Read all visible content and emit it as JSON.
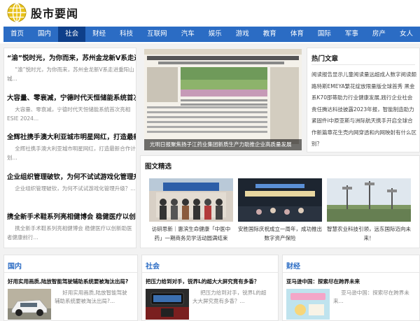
{
  "header": {
    "site_title": "股市要闻",
    "logo_icon": "globe-icon"
  },
  "nav": {
    "items": [
      "首页",
      "国内",
      "社会",
      "财经",
      "科技",
      "互联网",
      "汽车",
      "娱乐",
      "游戏",
      "教育",
      "体育",
      "国际",
      "军事",
      "房产",
      "女人"
    ],
    "active_index": 2
  },
  "colors": {
    "accent": "#2b6cc4",
    "nav_active": "#0e3f8a"
  },
  "left_news": [
    {
      "title": "“渝”悦时光，为你而来，苏州金龙新V系走进重",
      "desc": "“渝”悦时光，为你而来，苏州金龙新V系走进重阳山城..."
    },
    {
      "title": "大容量、零衰减，宁德时代天恒储能系统首次亮",
      "desc": "大容量、零衰减，宁德时代天恒储能系统首次亮相ESIE 2024..."
    },
    {
      "title": "全辉社携手澳大利亚城市明星网红，打造最新合",
      "desc": "全辉社携手澳大利亚城市明星网红，打造最新合作计划..."
    },
    {
      "title": "企业组织管理破钦，为何不试试游戏化管理升级",
      "desc": "企业组织管理破钦，为何不试试游戏化管理升级？..."
    },
    {
      "title": "携全新手术鞋系列亮相健博会 稳健医疗以创新康",
      "desc": "携全新手术鞋系列亮相健博会 稳健医疗以创新助医者健康前行..."
    }
  ],
  "featured_photo": {
    "caption": "光明日报聚焦扬子江药业集团新质生产力助推企业高质量发展"
  },
  "hot_articles": {
    "title": "热门文章",
    "text": "阅读报告显示儿童阅读量远超成人数字阅读颇路特斯EMEYA繁花绽放限量版全球首秀 黑金系K70邵蒂助力行业健康发展,践行企业社会责任腾达科技披露2023年报，智能制造助力紧固件i中原亚斯与洲际航天携手开启全球合作新篇章花生壳内网穿透和内网映射有什么区别？"
  },
  "gallery": {
    "title": "图文精选",
    "items": [
      {
        "caption": "访研思新｜惠滨生命健康「中医中药」一期商务见学活动圆满结束"
      },
      {
        "caption": "安胜国际庆祝成立一周年，成功推出数字资产保险"
      },
      {
        "caption": "智慧农业科技引领，远东国际迈向未来！"
      }
    ]
  },
  "sections": [
    {
      "title": "国内",
      "news_title": "好用实用画质,陆放智能驾驶辅助系统要被淘汰出局?",
      "desc": "好用实用画质,陆放智能驾驶辅助系统要被淘汰出局?..."
    },
    {
      "title": "社会",
      "news_title": "把压力给到对手，锐界L的超大大屏究竟有多香？",
      "desc": "把压力给到对手，锐界L的超大大屏究竟有多香？..."
    },
    {
      "title": "财经",
      "news_title": "亚马逊中国：探索尽在跨界未来",
      "desc": "亚马逊中国：探索尽在跨界未来..."
    }
  ]
}
